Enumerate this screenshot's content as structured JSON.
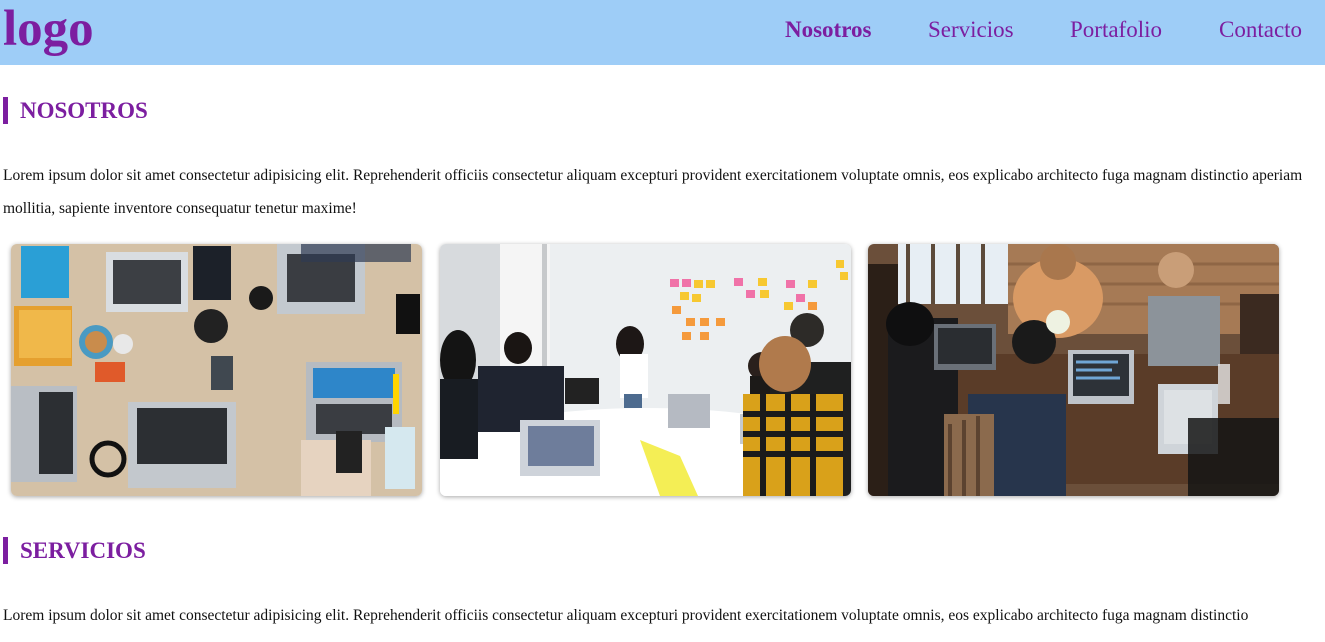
{
  "header": {
    "logo": "logo",
    "nav": [
      "Nosotros",
      "Servicios",
      "Portafolio",
      "Contacto"
    ],
    "active_nav": "Nosotros"
  },
  "sections": [
    {
      "title": "NOSOTROS",
      "text": "Lorem ipsum dolor sit amet consectetur adipisicing elit. Reprehenderit officiis consectetur aliquam excepturi provident exercitationem voluptate omnis, eos explicabo architecto fuga magnam distinctio aperiam mollitia, sapiente inventore consequatur tenetur maxime!"
    },
    {
      "title": "SERVICIOS",
      "text": "Lorem ipsum dolor sit amet consectetur adipisicing elit. Reprehenderit officiis consectetur aliquam excepturi provident exercitationem voluptate omnis, eos explicabo architecto fuga magnam distinctio"
    }
  ],
  "gallery": [
    {
      "subject": "team-desk-laptops-photo"
    },
    {
      "subject": "presentation-sticky-notes-photo"
    },
    {
      "subject": "team-meeting-laptops-photo"
    }
  ]
}
